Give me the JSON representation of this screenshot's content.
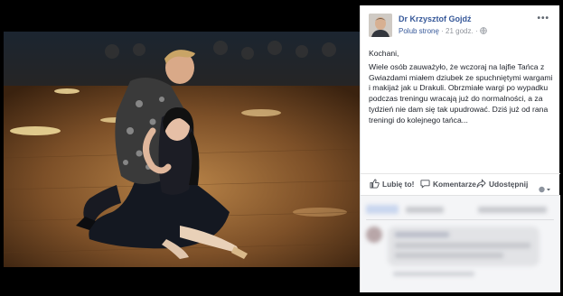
{
  "post": {
    "page_name": "Dr Krzysztof Gojdź",
    "like_page": "Polub stronę",
    "separator": " · ",
    "time": "21 godz.",
    "greeting": "Kochani,",
    "body": "Wiele osób zauważyło, że wczoraj na lajfie Tańca z Gwiazdami miałem dziubek ze spuchniętymi wargami i makijaż jak u Drakuli. Obrzmiałe wargi po wypadku podczas treningu wracają już do normalności, a za tydzień nie dam się tak upudrować. Dziś już od rana treningi do kolejnego tańca..."
  },
  "actions": {
    "like": "Lubię to!",
    "comment": "Komentarze",
    "share": "Udostępnij"
  },
  "icons": {
    "more": "more-options-icon",
    "globe": "globe-icon",
    "like": "thumbs-up-icon",
    "comment": "comment-bubble-icon",
    "share": "share-arrow-icon",
    "audience": "chevron-down-icon"
  },
  "colors": {
    "link": "#365899",
    "meta": "#90949c",
    "text": "#1d2129",
    "action": "#4b4f56",
    "comments_bg": "#f4f5f7"
  }
}
